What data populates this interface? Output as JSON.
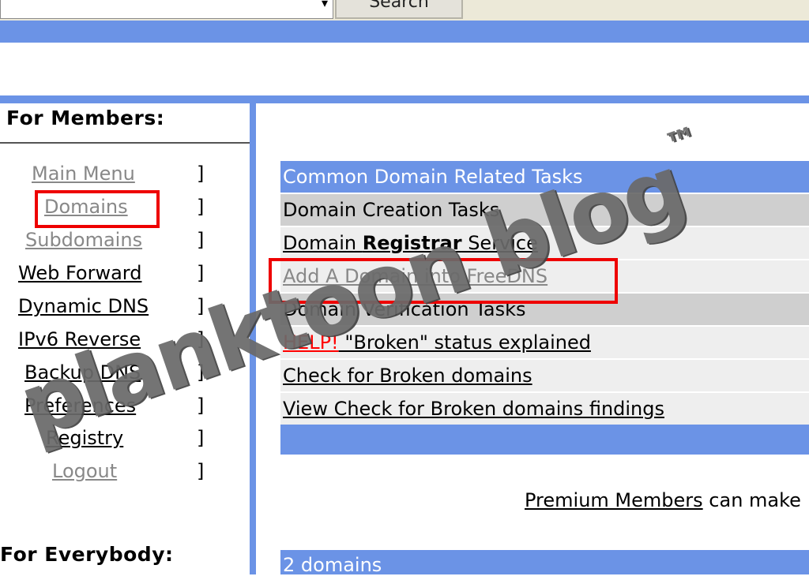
{
  "search": {
    "button_label": "Search"
  },
  "sidebar": {
    "members_heading": "For Members:",
    "everybody_heading": "For Everybody:",
    "items": [
      {
        "label": "Main Menu",
        "visited": true
      },
      {
        "label": "Domains",
        "visited": true
      },
      {
        "label": "Subdomains",
        "visited": true
      },
      {
        "label": "Web Forward",
        "visited": false
      },
      {
        "label": "Dynamic DNS",
        "visited": false
      },
      {
        "label": "IPv6 Reverse",
        "visited": false
      },
      {
        "label": "Backup DNS",
        "visited": false
      },
      {
        "label": "Preferences",
        "visited": false
      },
      {
        "label": "Registry",
        "visited": false
      },
      {
        "label": "Logout",
        "visited": true
      }
    ],
    "bracket": "]"
  },
  "tasks": {
    "header": "Common Domain Related Tasks",
    "creation_heading": "Domain Creation Tasks",
    "registrar_pre": "Domain ",
    "registrar_bold": "Registrar",
    "registrar_post": " Service",
    "add_domain": "Add A Domain into FreeDNS",
    "verification_heading": "Domain Verification Tasks",
    "help_label": "HELP!",
    "help_text": " \"Broken\" status explained",
    "check_broken": "Check for Broken domains",
    "view_broken": "View Check for Broken domains findings"
  },
  "premium": {
    "link": "Premium Members",
    "rest": " can make"
  },
  "domains_count": "2 domains",
  "watermark": {
    "text": "planktoon blog",
    "mark": "™"
  }
}
